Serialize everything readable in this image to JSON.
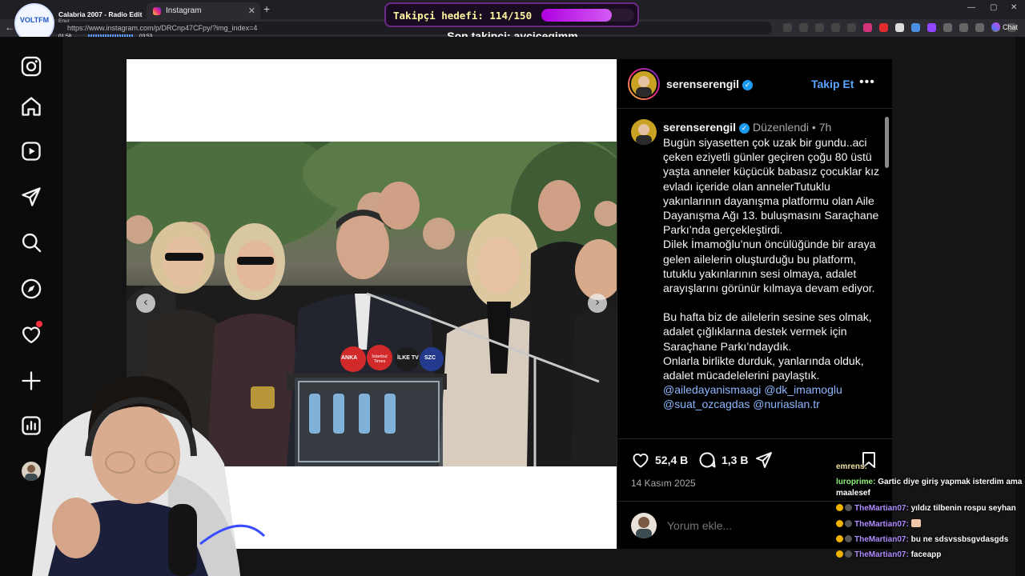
{
  "browser": {
    "tabs": [
      {
        "label": "Calabria 2007 - Radio Edit",
        "active": false
      },
      {
        "label": "Instagram",
        "active": true
      }
    ],
    "url": "https://www.instagram.com/p/DRCnp47CFpy/?img_index=4",
    "chat_button": "Chat"
  },
  "music": {
    "logo_text": "VOLTFM",
    "title": "Calabria 2007 - Radio Edit",
    "artist": "Enur",
    "time_elapsed": "01:58",
    "time_total": "03:53",
    "progress": 0.51
  },
  "stream_overlay": {
    "goal_label": "Takipçi hedefi: 114/150",
    "goal_current": 114,
    "goal_target": 150,
    "last_follower": "Son takipçi: aycicegimm"
  },
  "post": {
    "username": "serenserengil",
    "follow_label": "Takip Et",
    "edited_label": "Düzenlendi",
    "time_ago": "7h",
    "caption_p1": "Bugün siyasetten çok uzak bir gundu..aci çeken eziyetli günler geçiren çoğu 80 üstü yaşta anneler küçücük babasız çocuklar kız evladı içeride olan annelerTutuklu yakınlarının dayanışma platformu olan Aile Dayanışma Ağı 13. buluşmasını Saraçhane Parkı’nda gerçekleştirdi.",
    "caption_p2": "Dilek İmamoğlu’nun öncülüğünde bir araya gelen ailelerin oluşturduğu bu platform, tutuklu yakınlarının sesi olmaya, adalet arayışlarını görünür kılmaya devam ediyor.",
    "caption_p3": "Bu hafta biz de ailelerin sesine ses olmak, adalet çığlıklarına destek vermek için Saraçhane Parkı’ndaydık.",
    "caption_p4": "Onlarla birlikte durduk, yanlarında olduk, adalet mücadelelerini paylaştık.",
    "caption_tags": "@ailedayanismaagi @dk_imamoglu @suat_ozcagdas @nuriaslan.tr",
    "likes": "52,4 B",
    "comments": "1,3 B",
    "date": "14 Kasım 2025",
    "comment_placeholder": "Yorum ekle..."
  },
  "photo_mics": [
    "ANKA",
    "İstanbul Times",
    "İLKE TV",
    "SZC"
  ],
  "chat": [
    {
      "user": "emrens",
      "text": "",
      "color": "#f1e0a0"
    },
    {
      "user": "luroprime",
      "text": "Gartic diye giriş yapmak isterdim ama maalesef",
      "color": "#8ef07a"
    },
    {
      "user": "TheMartian07",
      "text": "yıldız tilbenin rospu seyhan",
      "color": "#b08cff"
    },
    {
      "user": "TheMartian07",
      "text": "",
      "color": "#b08cff"
    },
    {
      "user": "TheMartian07",
      "text": "bu ne sdsvssbsgvdasgds",
      "color": "#b08cff"
    },
    {
      "user": "TheMartian07",
      "text": "faceapp",
      "color": "#b08cff"
    }
  ]
}
